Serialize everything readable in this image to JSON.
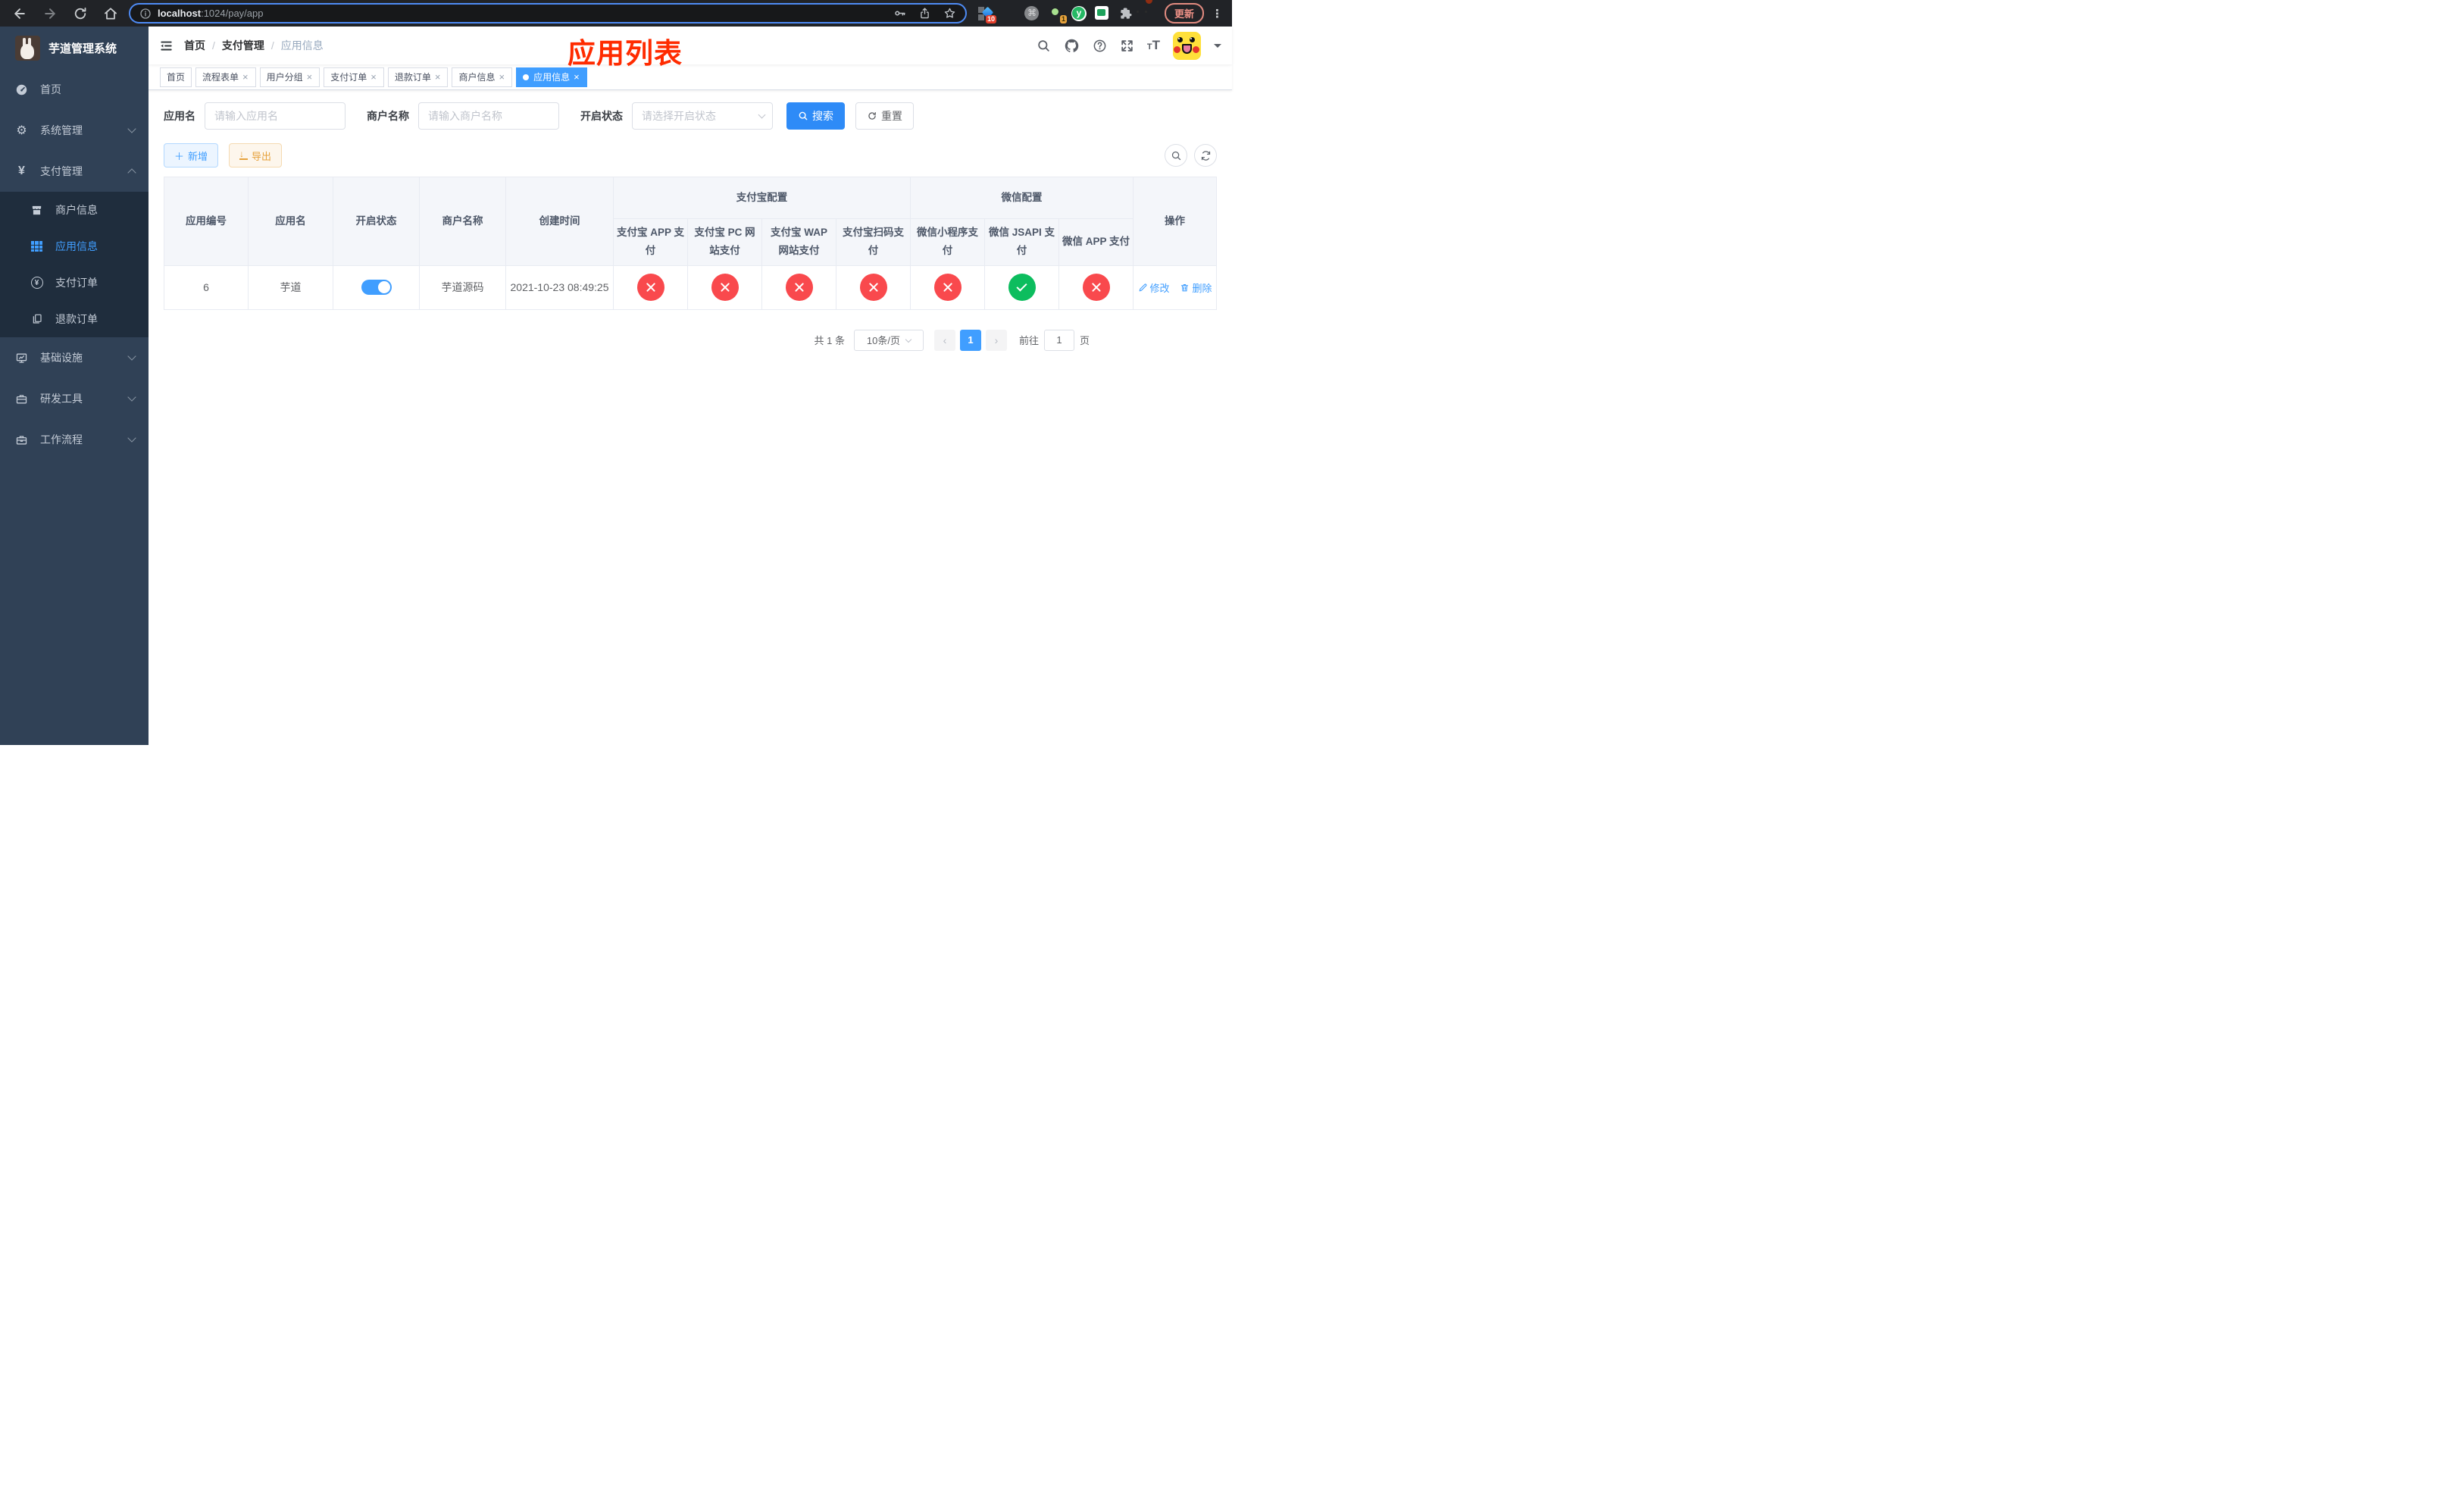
{
  "browser": {
    "url_host": "localhost",
    "url_path": ":1024/pay/app",
    "update_label": "更新",
    "ext_badge_grid": "10",
    "ext_badge_avatar": "1",
    "ext_y_letter": "y",
    "command_glyph": "⌘"
  },
  "icons": {
    "back": "arrow-left",
    "forward": "arrow-right",
    "reload": "circular-arrow",
    "home": "house",
    "info": "info-circle",
    "key": "key",
    "share": "share-up-arrow",
    "star": "star-outline",
    "extensions": "puzzle-piece",
    "more": "kebab-menu",
    "hamburger": "collapse-menu",
    "search": "magnifier",
    "github": "octocat",
    "help": "question-circle",
    "fullscreen": "expand-arrows",
    "font_size": "Tt",
    "caret": "triangle-down",
    "add": "plus",
    "export": "download-arrow",
    "edit": "pencil",
    "delete": "trash",
    "refresh": "sync"
  },
  "sidebar": {
    "title": "芋道管理系统",
    "items": [
      {
        "label": "首页"
      },
      {
        "label": "系统管理"
      },
      {
        "label": "支付管理"
      },
      {
        "label": "商户信息"
      },
      {
        "label": "应用信息"
      },
      {
        "label": "支付订单"
      },
      {
        "label": "退款订单"
      },
      {
        "label": "基础设施"
      },
      {
        "label": "研发工具"
      },
      {
        "label": "工作流程"
      }
    ]
  },
  "header": {
    "breadcrumb": [
      "首页",
      "支付管理",
      "应用信息"
    ],
    "overlay_title": "应用列表"
  },
  "tabs": [
    {
      "label": "首页"
    },
    {
      "label": "流程表单"
    },
    {
      "label": "用户分组"
    },
    {
      "label": "支付订单"
    },
    {
      "label": "退款订单"
    },
    {
      "label": "商户信息"
    },
    {
      "label": "应用信息"
    }
  ],
  "filters": {
    "app_name_label": "应用名",
    "app_name_placeholder": "请输入应用名",
    "merchant_label": "商户名称",
    "merchant_placeholder": "请输入商户名称",
    "status_label": "开启状态",
    "status_placeholder": "请选择开启状态",
    "search_label": "搜索",
    "reset_label": "重置"
  },
  "toolbar": {
    "add_label": "新增",
    "export_label": "导出"
  },
  "table": {
    "headers": {
      "app_id": "应用编号",
      "app_name": "应用名",
      "status": "开启状态",
      "merchant": "商户名称",
      "created": "创建时间",
      "alipay_group": "支付宝配置",
      "wechat_group": "微信配置",
      "actions": "操作",
      "pay_cols": [
        "支付宝 APP 支付",
        "支付宝 PC 网站支付",
        "支付宝 WAP 网站支付",
        "支付宝扫码支付",
        "微信小程序支付",
        "微信 JSAPI 支付",
        "微信 APP 支付"
      ]
    },
    "rows": [
      {
        "app_id": "6",
        "app_name": "芋道",
        "enabled": true,
        "merchant": "芋道源码",
        "created": "2021-10-23 08:49:25",
        "pay_status": [
          "fail",
          "fail",
          "fail",
          "fail",
          "fail",
          "ok",
          "fail"
        ],
        "edit_label": "修改",
        "delete_label": "删除"
      }
    ]
  },
  "pagination": {
    "total_text": "共 1 条",
    "page_size": "10条/页",
    "current": "1",
    "goto_label": "前往",
    "goto_value": "1",
    "page_unit": "页"
  },
  "colors": {
    "primary": "#409eff",
    "success": "#0cbd5e",
    "danger": "#f9494d",
    "sidebar_bg": "#304156",
    "submenu_bg": "#1f2d3d",
    "title_red": "#ff2b00",
    "export_orange": "#e6a23c",
    "header_bg": "#f4f6fa"
  }
}
